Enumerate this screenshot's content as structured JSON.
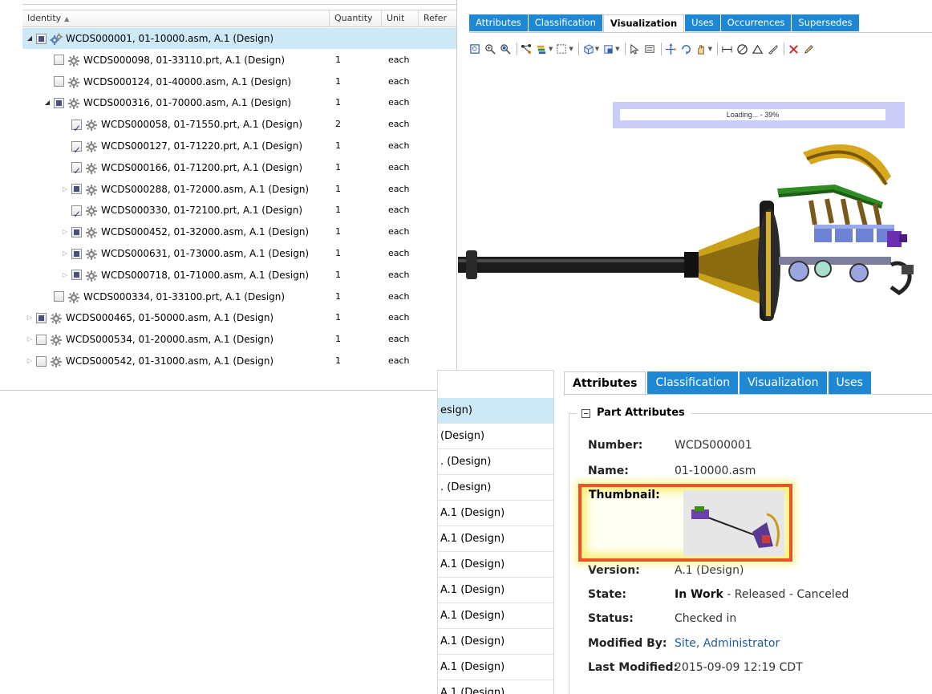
{
  "tree": {
    "columns": {
      "identity": "Identity",
      "quantity": "Quantity",
      "unit": "Unit",
      "reference": "Refer"
    },
    "rows": [
      {
        "id": "WCDS000001, 01-10000.asm, A.1 (Design)",
        "qty": "",
        "unit": "",
        "level": 0,
        "expander": "open",
        "checkbox": "partial",
        "icon": "assembly-icon",
        "selected": true
      },
      {
        "id": "WCDS000098, 01-33110.prt, A.1 (Design)",
        "qty": "1",
        "unit": "each",
        "level": 1,
        "expander": "none",
        "checkbox": "unchecked",
        "icon": "gear-icon"
      },
      {
        "id": "WCDS000124, 01-40000.asm, A.1 (Design)",
        "qty": "1",
        "unit": "each",
        "level": 1,
        "expander": "none",
        "checkbox": "unchecked",
        "icon": "gear-icon"
      },
      {
        "id": "WCDS000316, 01-70000.asm, A.1 (Design)",
        "qty": "1",
        "unit": "each",
        "level": 1,
        "expander": "open",
        "checkbox": "partial",
        "icon": "gear-icon"
      },
      {
        "id": "WCDS000058, 01-71550.prt, A.1 (Design)",
        "qty": "2",
        "unit": "each",
        "level": 2,
        "expander": "none",
        "checkbox": "checked",
        "icon": "gear-icon"
      },
      {
        "id": "WCDS000127, 01-71220.prt, A.1 (Design)",
        "qty": "1",
        "unit": "each",
        "level": 2,
        "expander": "none",
        "checkbox": "checked",
        "icon": "gear-icon"
      },
      {
        "id": "WCDS000166, 01-71200.prt, A.1 (Design)",
        "qty": "1",
        "unit": "each",
        "level": 2,
        "expander": "none",
        "checkbox": "checked",
        "icon": "gear-icon"
      },
      {
        "id": "WCDS000288, 01-72000.asm, A.1 (Design)",
        "qty": "1",
        "unit": "each",
        "level": 2,
        "expander": "closed",
        "checkbox": "partial",
        "icon": "gear-icon"
      },
      {
        "id": "WCDS000330, 01-72100.prt, A.1 (Design)",
        "qty": "1",
        "unit": "each",
        "level": 2,
        "expander": "none",
        "checkbox": "checked",
        "icon": "gear-icon"
      },
      {
        "id": "WCDS000452, 01-32000.asm, A.1 (Design)",
        "qty": "1",
        "unit": "each",
        "level": 2,
        "expander": "closed",
        "checkbox": "partial",
        "icon": "gear-icon"
      },
      {
        "id": "WCDS000631, 01-73000.asm, A.1 (Design)",
        "qty": "1",
        "unit": "each",
        "level": 2,
        "expander": "closed",
        "checkbox": "partial",
        "icon": "gear-icon"
      },
      {
        "id": "WCDS000718, 01-71000.asm, A.1 (Design)",
        "qty": "1",
        "unit": "each",
        "level": 2,
        "expander": "closed",
        "checkbox": "partial",
        "icon": "gear-icon"
      },
      {
        "id": "WCDS000334, 01-33100.prt, A.1 (Design)",
        "qty": "1",
        "unit": "each",
        "level": 1,
        "expander": "none",
        "checkbox": "unchecked",
        "icon": "gear-icon"
      },
      {
        "id": "WCDS000465, 01-50000.asm, A.1 (Design)",
        "qty": "1",
        "unit": "each",
        "level": 0,
        "expander": "closed",
        "checkbox": "partial",
        "icon": "gear-icon"
      },
      {
        "id": "WCDS000534, 01-20000.asm, A.1 (Design)",
        "qty": "1",
        "unit": "each",
        "level": 0,
        "expander": "closed",
        "checkbox": "unchecked",
        "icon": "gear-icon"
      },
      {
        "id": "WCDS000542, 01-31000.asm, A.1 (Design)",
        "qty": "1",
        "unit": "each",
        "level": 0,
        "expander": "closed",
        "checkbox": "unchecked",
        "icon": "gear-icon"
      }
    ]
  },
  "viz": {
    "tabs": [
      "Attributes",
      "Classification",
      "Visualization",
      "Uses",
      "Occurrences",
      "Supersedes"
    ],
    "active_tab": "Visualization",
    "toolbar_icons": [
      "zoom-box-icon",
      "zoom-in-icon",
      "zoom-selected-icon",
      "sep",
      "structure-icon",
      "layers-icon",
      "selection-box-icon",
      "sep",
      "view-cube-icon",
      "orientation-icon",
      "sep",
      "pointer-icon",
      "select-window-icon",
      "sep",
      "move-icon",
      "rotate-icon",
      "hand-icon",
      "sep",
      "measure-distance-icon",
      "measure-diameter-icon",
      "measure-angle-icon",
      "ruler-icon",
      "sep",
      "delete-icon",
      "pencil-icon"
    ],
    "loading": {
      "text": "Loading... - 39%",
      "progress": 0.39
    }
  },
  "strip": {
    "rows": [
      "esign)",
      "(Design)",
      ". (Design)",
      ". (Design)",
      "A.1 (Design)",
      "A.1 (Design)",
      "A.1 (Design)",
      "A.1 (Design)",
      "A.1 (Design)",
      "A.1 (Design)",
      "A.1 (Design)",
      "A.1 (Design)"
    ]
  },
  "attributes": {
    "tabs": [
      "Attributes",
      "Classification",
      "Visualization",
      "Uses"
    ],
    "active_tab": "Attributes",
    "group_title": "Part Attributes",
    "number": {
      "label": "Number:",
      "value": "WCDS000001"
    },
    "name": {
      "label": "Name:",
      "value": "01-10000.asm"
    },
    "thumbnail": {
      "label": "Thumbnail:"
    },
    "version": {
      "label": "Version:",
      "value": "A.1 (Design)"
    },
    "state": {
      "label": "State:",
      "current": "In Work",
      "rest": " - Released - Canceled"
    },
    "status": {
      "label": "Status:",
      "value": "Checked in"
    },
    "modified_by": {
      "label": "Modified By:",
      "value": "Site, Administrator"
    },
    "last_modified": {
      "label": "Last Modified:",
      "value": "2015-09-09 12:19 CDT"
    }
  },
  "colors": {
    "tab_blue": "#1e88d4",
    "selection": "#cde8f7",
    "highlight_border": "#e9542b",
    "link": "#1f5aa5"
  }
}
